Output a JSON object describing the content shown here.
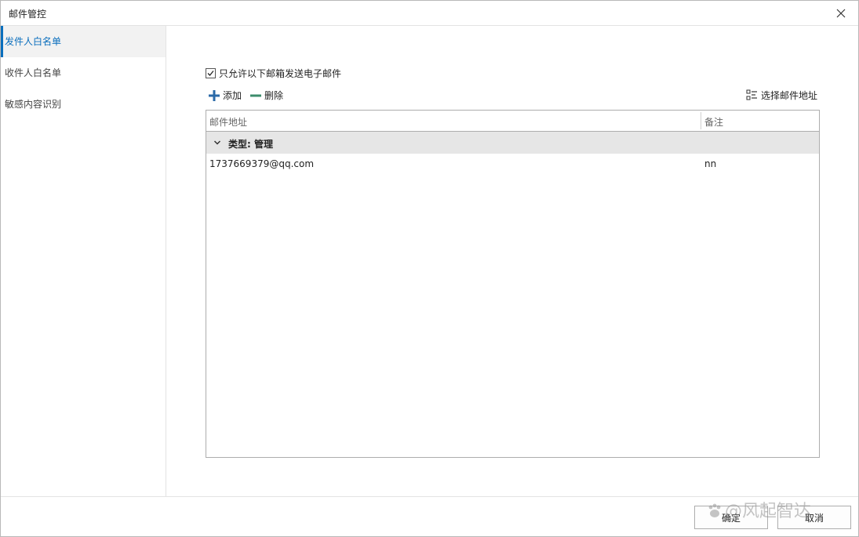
{
  "window": {
    "title": "邮件管控"
  },
  "sidebar": {
    "items": [
      {
        "label": "发件人白名单",
        "active": true
      },
      {
        "label": "收件人白名单",
        "active": false
      },
      {
        "label": "敏感内容识别",
        "active": false
      }
    ]
  },
  "main": {
    "allow_checkbox": {
      "label": "只允许以下邮箱发送电子邮件",
      "checked": true
    },
    "toolbar": {
      "add_label": "添加",
      "delete_label": "删除",
      "select_address_label": "选择邮件地址"
    },
    "grid": {
      "columns": [
        "邮件地址",
        "备注"
      ],
      "group_label": "类型: 管理",
      "rows": [
        {
          "email": "1737669379@qq.com",
          "note": "nn"
        }
      ]
    }
  },
  "footer": {
    "ok_label": "确定",
    "cancel_label": "取消"
  },
  "watermark": {
    "text": "@风起智达"
  },
  "colors": {
    "accent": "#0a6ebd",
    "add_icon": "#2b6aa8",
    "delete_icon": "#3c8c6c"
  }
}
